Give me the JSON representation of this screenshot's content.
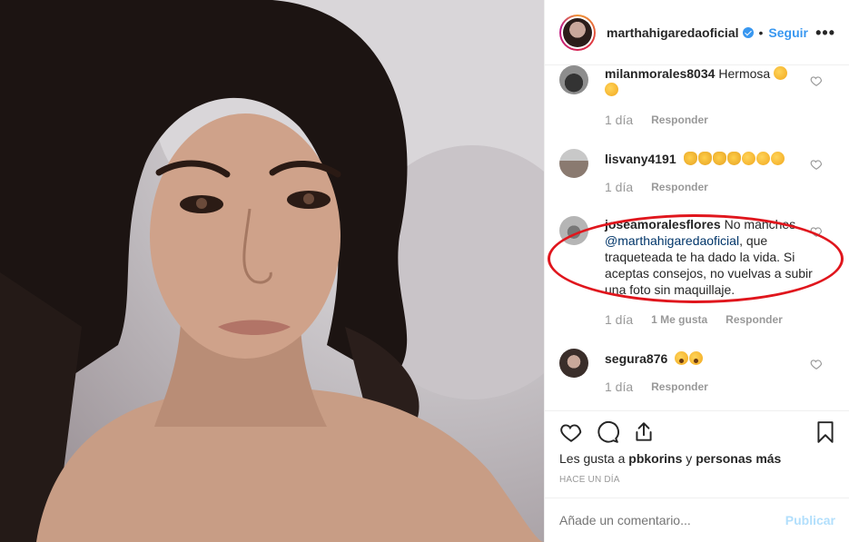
{
  "header": {
    "username": "marthahigaredaoficial",
    "separator": "•",
    "follow_label": "Seguir",
    "more_label": "•••"
  },
  "comments": [
    {
      "username": "milanmorales8034",
      "text": "Hermosa",
      "emojis": [
        "kiss",
        "kiss"
      ],
      "time": "1 día",
      "reply_label": "Responder"
    },
    {
      "username": "lisvany4191",
      "text": "",
      "emojis": [
        "clap",
        "clap",
        "clap",
        "clap",
        "kiss",
        "kiss",
        "kiss"
      ],
      "time": "1 día",
      "reply_label": "Responder"
    },
    {
      "username": "joseamoralesflores",
      "text_before": "No manches",
      "mention": "@marthahigaredaoficial",
      "text_after": ", que traqueteada te ha dado la vida. Si aceptas consejos, no vuelvas a subir una foto sin maquillaje.",
      "time": "1 día",
      "likes_label": "1 Me gusta",
      "reply_label": "Responder"
    },
    {
      "username": "segura876",
      "text": "",
      "emojis": [
        "wow",
        "wow"
      ],
      "time": "1 día",
      "reply_label": "Responder"
    }
  ],
  "actions": {
    "likes_prefix": "Les gusta a",
    "liked_by": "pbkorins",
    "likes_joiner": "y",
    "likes_rest": "personas más",
    "timestamp": "HACE UN DÍA"
  },
  "add_comment": {
    "placeholder": "Añade un comentario...",
    "publish_label": "Publicar"
  },
  "colors": {
    "accent": "#3897f0",
    "highlight": "#e0161d",
    "muted": "#999999",
    "publish_disabled": "#b2dffc"
  },
  "icons": [
    "verified-badge-icon",
    "more-options-icon",
    "heart-icon",
    "comment-icon",
    "share-icon",
    "bookmark-icon"
  ]
}
